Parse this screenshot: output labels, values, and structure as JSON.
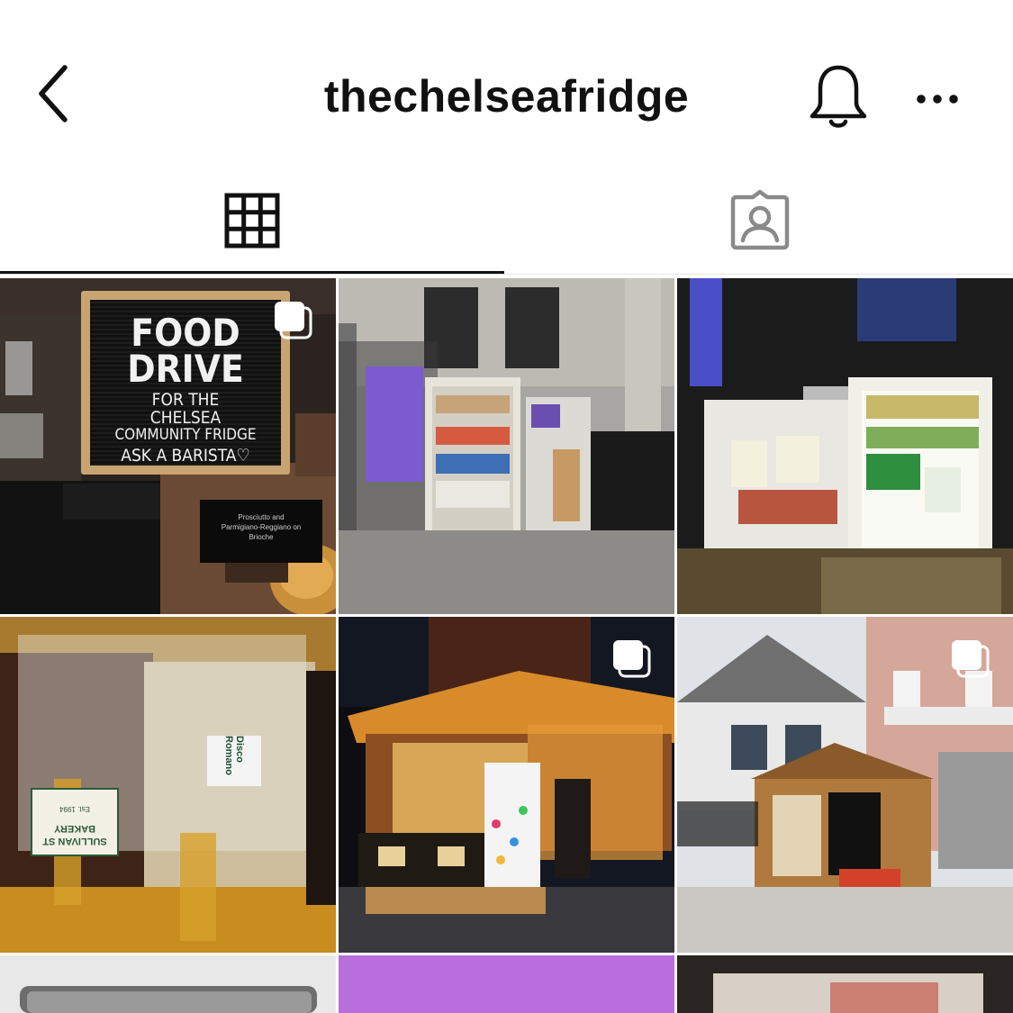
{
  "header": {
    "title": "thechelseafridge",
    "back_icon": "chevron-left-icon",
    "bell_icon": "bell-icon",
    "more_icon": "more-horizontal-icon"
  },
  "tabs": [
    {
      "name": "posts-grid",
      "icon": "grid-icon",
      "active": true
    },
    {
      "name": "tagged",
      "icon": "tagged-person-icon",
      "active": false
    }
  ],
  "posts": [
    {
      "id": "food-drive",
      "multi": true,
      "sign_lines": [
        "FOOD",
        "DRIVE",
        "FOR THE",
        "CHELSEA",
        "COMMUNITY FRIDGE",
        "ASK A BARISTA♡"
      ],
      "placard": [
        "Prosciutto and",
        "Parmigiano-Reggiano on",
        "Brioche"
      ]
    },
    {
      "id": "street-fridge-church",
      "multi": false
    },
    {
      "id": "open-fridge-night",
      "multi": false
    },
    {
      "id": "bread-bags",
      "multi": false,
      "label_lines": [
        "SULLIVAN ST",
        "BAKERY"
      ],
      "label_small": "Est. 1994",
      "disco_label": "Disco Romano"
    },
    {
      "id": "night-cafe-fridge",
      "multi": true
    },
    {
      "id": "wooden-shed-fridge",
      "multi": true
    },
    {
      "id": "row3-a",
      "multi": false
    },
    {
      "id": "row3-b",
      "multi": false
    },
    {
      "id": "row3-c",
      "multi": false
    }
  ],
  "colors": {
    "text": "#111111",
    "divider": "#e6e6e6",
    "purple_tile": "#b86edc"
  }
}
